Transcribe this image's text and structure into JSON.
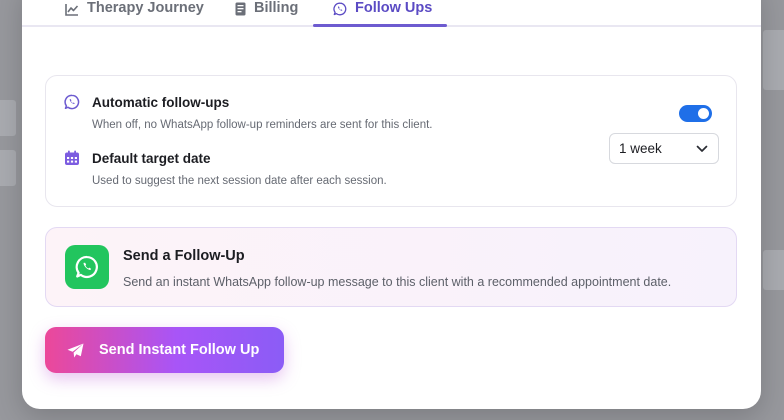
{
  "tabs": [
    {
      "label": "Therapy Journey",
      "icon": "chart-line-icon",
      "active": false
    },
    {
      "label": "Billing",
      "icon": "receipt-icon",
      "active": false
    },
    {
      "label": "Follow Ups",
      "icon": "whatsapp-icon",
      "active": true
    }
  ],
  "settings": {
    "auto_followups": {
      "title": "Automatic follow-ups",
      "description": "When off, no WhatsApp follow-up reminders are sent for this client.",
      "enabled": true
    },
    "target_date": {
      "title": "Default target date",
      "description": "Used to suggest the next session date after each session.",
      "selected": "1 week"
    }
  },
  "followup_card": {
    "title": "Send a Follow-Up",
    "description": "Send an instant WhatsApp follow-up message to this client with a recommended appointment date."
  },
  "send_button": {
    "label": "Send Instant Follow Up"
  },
  "colors": {
    "accent": "#5b4bc4",
    "toggle_on": "#1f6fe8",
    "whatsapp_green": "#22c55e",
    "button_gradient_start": "#ec4899",
    "button_gradient_end": "#8b5cf6"
  }
}
